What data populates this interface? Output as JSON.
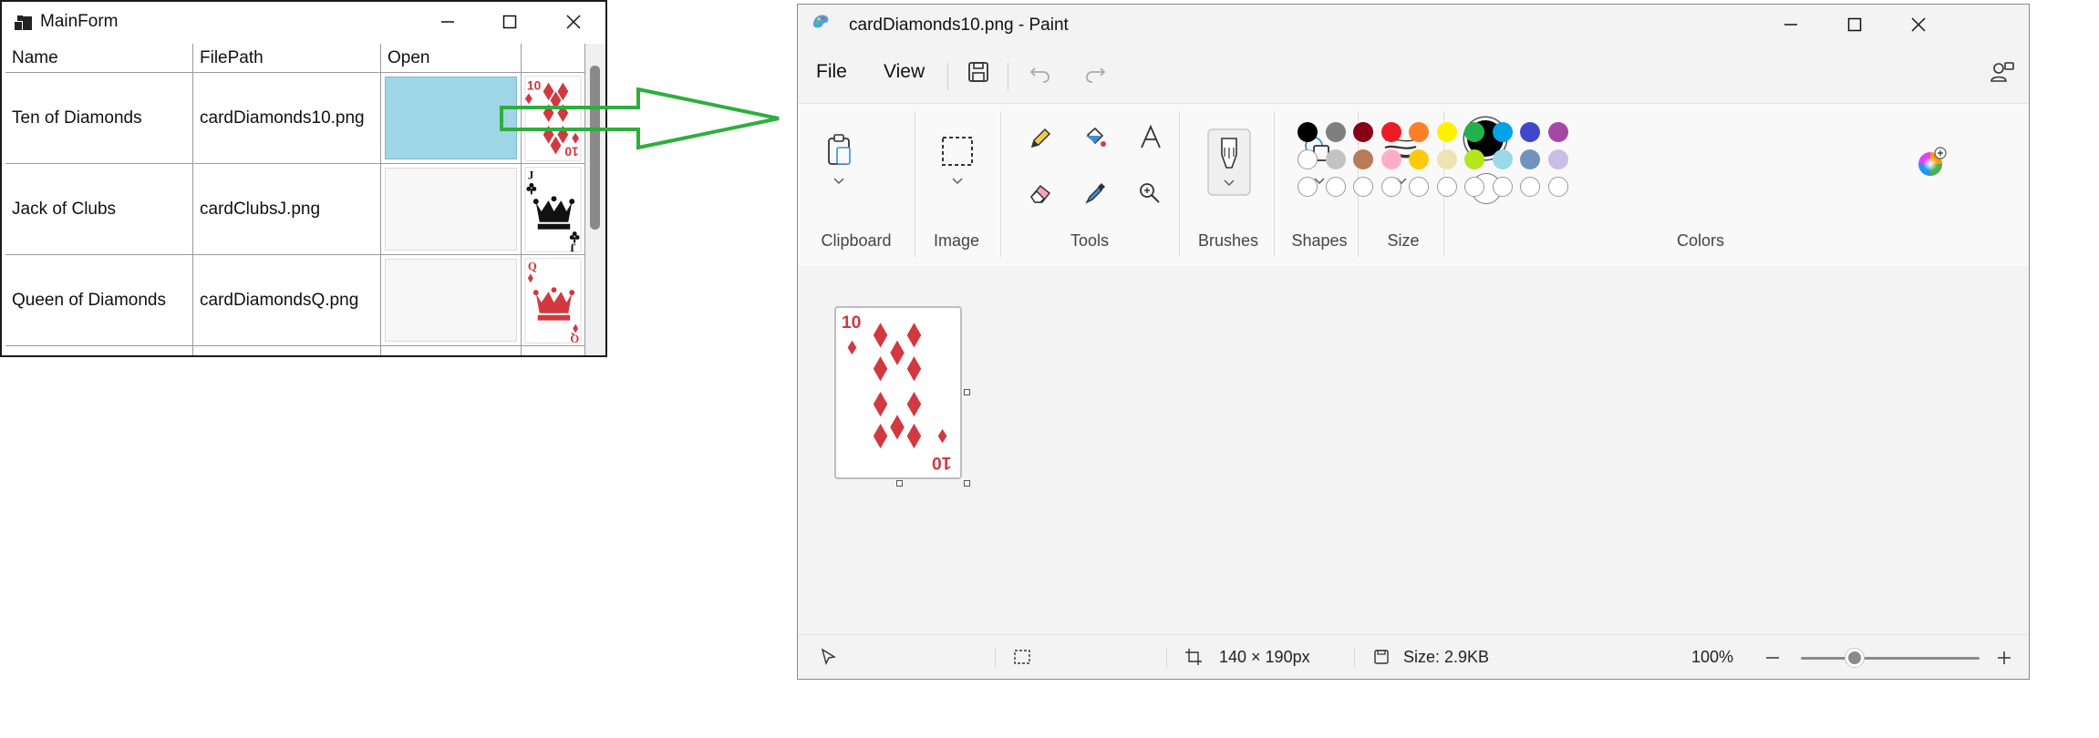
{
  "mainform": {
    "title": "MainForm",
    "columns": [
      "Name",
      "FilePath",
      "Open",
      ""
    ],
    "rows": [
      {
        "name": "Ten of Diamonds",
        "path": "cardDiamonds10.png",
        "card_rank": "10",
        "suit": "diamonds",
        "open_highlight": true
      },
      {
        "name": "Jack of Clubs",
        "path": "cardClubsJ.png",
        "card_rank": "J",
        "suit": "clubs",
        "open_highlight": false
      },
      {
        "name": "Queen of Diamonds",
        "path": "cardDiamondsQ.png",
        "card_rank": "Q",
        "suit": "diamonds",
        "open_highlight": false
      }
    ]
  },
  "paint": {
    "title": "cardDiamonds10.png - Paint",
    "menu": {
      "file": "File",
      "view": "View"
    },
    "groups": {
      "clipboard": "Clipboard",
      "image": "Image",
      "tools": "Tools",
      "brushes": "Brushes",
      "shapes": "Shapes",
      "size": "Size",
      "colors": "Colors"
    },
    "palette_row1": [
      "#000000",
      "#7f7f7f",
      "#880015",
      "#ed1c24",
      "#ff7f27",
      "#fff200",
      "#22b14c",
      "#00a2e8",
      "#3f48cc",
      "#a349a4"
    ],
    "palette_row2": [
      "#ffffff",
      "#c3c3c3",
      "#b97a57",
      "#ffaec9",
      "#ffc90e",
      "#efe4b0",
      "#b5e61d",
      "#99d9ea",
      "#7092be",
      "#c8bfe7"
    ],
    "primary_color": "#000000",
    "secondary_color": "#ffffff",
    "canvas_card": {
      "rank": "10",
      "suit": "diamonds",
      "color": "#d2383f"
    },
    "status": {
      "dimensions": "140 × 190px",
      "size": "Size: 2.9KB",
      "zoom": "100%",
      "zoom_level": 0.3
    }
  },
  "colors": {
    "arrow": "#2eae3d",
    "open_highlight": "#9fd6e6",
    "card_red": "#d2383f"
  }
}
